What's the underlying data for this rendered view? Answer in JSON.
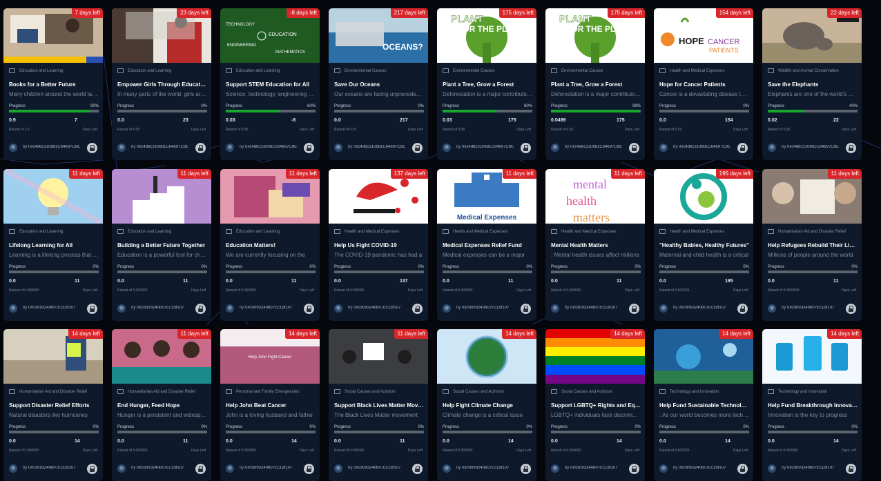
{
  "campaigns": [
    {
      "category": "Education and Learning",
      "title": "Books for a Better Future",
      "description": "Many children around the world lack access to books",
      "progress_label": "Progress",
      "progress_pct_text": "90%",
      "progress": 0.9,
      "raised": "0.9",
      "raised_of": "Raised of 1.0",
      "days": "7",
      "days_left_label": "Days Left",
      "days_badge": "7 days left",
      "creator_prefix": "by",
      "creator": "0xc4d6c310881C64697C8E",
      "thumb": "books"
    },
    {
      "category": "Education and Learning",
      "title": "Empower Girls Through Education",
      "description": "In many parts of the world, girls are denied",
      "progress_label": "Progress",
      "progress_pct_text": "0%",
      "progress": 0,
      "raised": "0.0",
      "raised_of": "Raised of 0.05",
      "days": "23",
      "days_left_label": "Days Left",
      "days_badge": "23 days left",
      "creator_prefix": "by",
      "creator": "0xc4d6c310881C64697C8E",
      "thumb": "girls"
    },
    {
      "category": "Education and Learning",
      "title": "Support STEM Education for All",
      "description": "Science, technology, engineering and math",
      "progress_label": "Progress",
      "progress_pct_text": "60%",
      "progress": 0.6,
      "raised": "0.03",
      "raised_of": "Raised of 0.05",
      "days": "-8",
      "days_left_label": "Days Left",
      "days_badge": "-8 days left",
      "creator_prefix": "by",
      "creator": "0xc4d6c310881C64697C8E",
      "thumb": "stem"
    },
    {
      "category": "Environmental Causes",
      "title": "Save Our Oceans",
      "description": "Our oceans are facing unprecedented threats",
      "progress_label": "Progress",
      "progress_pct_text": "0%",
      "progress": 0,
      "raised": "0.0",
      "raised_of": "Raised of 0.05",
      "days": "217",
      "days_left_label": "Days Left",
      "days_badge": "217 days left",
      "creator_prefix": "by",
      "creator": "0xc4d6c310881C64697C8E",
      "thumb": "oceans"
    },
    {
      "category": "Environmental Causes",
      "title": "Plant a Tree, Grow a Forest",
      "description": "Deforestation is a major contributor to climate",
      "progress_label": "Progress",
      "progress_pct_text": "60%",
      "progress": 0.6,
      "raised": "0.03",
      "raised_of": "Raised of 0.05",
      "days": "175",
      "days_left_label": "Days Left",
      "days_badge": "175 days left",
      "creator_prefix": "by",
      "creator": "0xc4d6c310881C64697C8E",
      "thumb": "plant"
    },
    {
      "category": "Environmental Causes",
      "title": "Plant a Tree, Grow a Forest",
      "description": "Deforestation is a major contributor to climate",
      "progress_label": "Progress",
      "progress_pct_text": "99%",
      "progress": 0.99,
      "raised": "0.0499",
      "raised_of": "Raised of 0.05",
      "days": "175",
      "days_left_label": "Days Left",
      "days_badge": "175 days left",
      "creator_prefix": "by",
      "creator": "0xc4d6c310881C64697C8E",
      "thumb": "plant"
    },
    {
      "category": "Health and Medical Expenses",
      "title": "Hope for Cancer Patients",
      "description": "Cancer is a devastating disease that affects",
      "progress_label": "Progress",
      "progress_pct_text": "0%",
      "progress": 0,
      "raised": "0.0",
      "raised_of": "Raised of 0.05",
      "days": "154",
      "days_left_label": "Days Left",
      "days_badge": "154 days left",
      "creator_prefix": "by",
      "creator": "0xc4d6c310881C64697C8E",
      "thumb": "hope"
    },
    {
      "category": "Wildlife and Animal Conservation",
      "title": "Save the Elephants",
      "description": "Elephants are one of the world's most iconic",
      "progress_label": "Progress",
      "progress_pct_text": "40%",
      "progress": 0.4,
      "raised": "0.02",
      "raised_of": "Raised of 0.05",
      "days": "22",
      "days_left_label": "Days Left",
      "days_badge": "22 days left",
      "creator_prefix": "by",
      "creator": "0xc4d6c310881C64697C8E",
      "thumb": "elephant"
    },
    {
      "category": "Education and Learning",
      "title": "Lifelong Learning for All",
      "description": "Learning is a lifelong process that helps",
      "progress_label": "Progress",
      "progress_pct_text": "0%",
      "progress": 0,
      "raised": "0.0",
      "raised_of": "Raised of 0.000000",
      "days": "11",
      "days_left_label": "Days Left",
      "days_badge": "11 days left",
      "creator_prefix": "by",
      "creator": "0x03093240b07Ec1df107",
      "thumb": "bulb"
    },
    {
      "category": "Education and Learning",
      "title": "Building a Better Future Together",
      "description": "Education is a powerful tool for change",
      "progress_label": "Progress",
      "progress_pct_text": "0%",
      "progress": 0,
      "raised": "0.0",
      "raised_of": "Raised of 0.000000",
      "days": "11",
      "days_left_label": "Days Left",
      "days_badge": "11 days left",
      "creator_prefix": "by",
      "creator": "0x03093240b07Ec1df107",
      "thumb": "future"
    },
    {
      "category": "Education and Learning",
      "title": "Education Matters!",
      "description": "We are currently focusing on the",
      "progress_label": "Progress",
      "progress_pct_text": "0%",
      "progress": 0,
      "raised": "0.0",
      "raised_of": "Raised of 0.000000",
      "days": "11",
      "days_left_label": "Days Left",
      "days_badge": "11 days left",
      "creator_prefix": "by",
      "creator": "0x03093240b07Ec1df107",
      "thumb": "edumatters"
    },
    {
      "category": "Health and Medical Expenses",
      "title": "Help Us Fight COVID-19",
      "description": "The COVID-19 pandemic has had a",
      "progress_label": "Progress",
      "progress_pct_text": "0%",
      "progress": 0,
      "raised": "0.0",
      "raised_of": "Raised of 0.000000",
      "days": "137",
      "days_left_label": "Days Left",
      "days_badge": "137 days left",
      "creator_prefix": "by",
      "creator": "0x03093240b07Ec1df107",
      "thumb": "covid"
    },
    {
      "category": "Health and Medical Expenses",
      "title": "Medical Expenses Relief Fund",
      "description": "Medical expenses can be a major",
      "progress_label": "Progress",
      "progress_pct_text": "0%",
      "progress": 0,
      "raised": "0.0",
      "raised_of": "Raised of 0.000000",
      "days": "11",
      "days_left_label": "Days Left",
      "days_badge": "11 days left",
      "creator_prefix": "by",
      "creator": "0x03093240b07Ec1df107",
      "thumb": "medical",
      "thumb_text": "Medical Expenses"
    },
    {
      "category": "Health and Medical Expenses",
      "title": "Mental Health Matters",
      "description": ": Mental health issues affect millions",
      "progress_label": "Progress",
      "progress_pct_text": "0%",
      "progress": 0,
      "raised": "0.0",
      "raised_of": "Raised of 0.000000",
      "days": "11",
      "days_left_label": "Days Left",
      "days_badge": "11 days left",
      "creator_prefix": "by",
      "creator": "0x03093240b07Ec1df107",
      "thumb": "mental"
    },
    {
      "category": "Health and Medical Expenses",
      "title": "\"Healthy Babies, Healthy Futures\"",
      "description": "Maternal and child health is a critical",
      "progress_label": "Progress",
      "progress_pct_text": "0%",
      "progress": 0,
      "raised": "0.0",
      "raised_of": "Raised of 0.000000",
      "days": "195",
      "days_left_label": "Days Left",
      "days_badge": "195 days left",
      "creator_prefix": "by",
      "creator": "0x03093240b07Ec1df107",
      "thumb": "babies"
    },
    {
      "category": "Humanitarian Aid and Disaster Relief",
      "title": "Help Refugees Rebuild Their Lives",
      "description": "Millions of people around the world",
      "progress_label": "Progress",
      "progress_pct_text": "0%",
      "progress": 0,
      "raised": "0.0",
      "raised_of": "Raised of 0.0000001",
      "days": "11",
      "days_left_label": "Days Left",
      "days_badge": "11 days left",
      "creator_prefix": "by",
      "creator": "0x03093240b07Ec1df107",
      "thumb": "refugees"
    },
    {
      "category": "Humanitarian Aid and Disaster Relief",
      "title": "Support Disaster Relief Efforts",
      "description": "Natural disasters like hurricanes",
      "progress_label": "Progress",
      "progress_pct_text": "0%",
      "progress": 0,
      "raised": "0.0",
      "raised_of": "Raised of 0.000000",
      "days": "14",
      "days_left_label": "Days Left",
      "days_badge": "14 days left",
      "creator_prefix": "by",
      "creator": "0x03093240b07Ec1df107",
      "thumb": "disaster"
    },
    {
      "category": "Humanitarian Aid and Disaster Relief",
      "title": "End Hunger, Feed Hope",
      "description": "Hunger is a persistent and widespread",
      "progress_label": "Progress",
      "progress_pct_text": "0%",
      "progress": 0,
      "raised": "0.0",
      "raised_of": "Raised of 0.000000",
      "days": "11",
      "days_left_label": "Days Left",
      "days_badge": "11 days left",
      "creator_prefix": "by",
      "creator": "0x03093240b07Ec1df107",
      "thumb": "hunger"
    },
    {
      "category": "Personal and Family Emergencies",
      "title": "Help John Beat Cancer",
      "description": "John is a loving husband and father",
      "progress_label": "Progress",
      "progress_pct_text": "0%",
      "progress": 0,
      "raised": "0.0",
      "raised_of": "Raised of 0.000000",
      "days": "14",
      "days_left_label": "Days Left",
      "days_badge": "14 days left",
      "creator_prefix": "by",
      "creator": "0x03093240b07Ec1df107",
      "thumb": "john",
      "thumb_text": "Help John Fight Cancer"
    },
    {
      "category": "Social Causes and Activism",
      "title": "Support Black Lives Matter Movement",
      "description": "The Black Lives Matter movement",
      "progress_label": "Progress",
      "progress_pct_text": "0%",
      "progress": 0,
      "raised": "0.0",
      "raised_of": "Raised of 0.000000",
      "days": "11",
      "days_left_label": "Days Left",
      "days_badge": "11 days left",
      "creator_prefix": "by",
      "creator": "0x03093240b07Ec1df107",
      "thumb": "blm"
    },
    {
      "category": "Social Causes and Activism",
      "title": "Help Fight Climate Change",
      "description": "Climate change is a critical issue",
      "progress_label": "Progress",
      "progress_pct_text": "0%",
      "progress": 0,
      "raised": "0.0",
      "raised_of": "Raised of 0.000000",
      "days": "14",
      "days_left_label": "Days Left",
      "days_badge": "14 days left",
      "creator_prefix": "by",
      "creator": "0x03093240b07Ec1df107",
      "thumb": "climate"
    },
    {
      "category": "Social Causes and Activism",
      "title": "Support LGBTQ+ Rights and Equality",
      "description": "LGBTQ+ individuals face discrimination",
      "progress_label": "Progress",
      "progress_pct_text": "0%",
      "progress": 0,
      "raised": "0.0",
      "raised_of": "Raised of 0.000000",
      "days": "14",
      "days_left_label": "Days Left",
      "days_badge": "14 days left",
      "creator_prefix": "by",
      "creator": "0x03093240b07Ec1df107",
      "thumb": "lgbt"
    },
    {
      "category": "Technology and Innovation",
      "title": "Help Fund Sustainable Technology",
      "description": ": As our world becomes more technology",
      "progress_label": "Progress",
      "progress_pct_text": "0%",
      "progress": 0,
      "raised": "0.0",
      "raised_of": "Raised of 0.000000",
      "days": "14",
      "days_left_label": "Days Left",
      "days_badge": "14 days left",
      "creator_prefix": "by",
      "creator": "0x03093240b07Ec1df107",
      "thumb": "sustain"
    },
    {
      "category": "Technology and Innovation",
      "title": "Help Fund Breakthrough Innovation",
      "description": "Innovation is the key to progress",
      "progress_label": "Progress",
      "progress_pct_text": "0%",
      "progress": 0,
      "raised": "0.0",
      "raised_of": "Raised of 0.000000",
      "days": "14",
      "days_left_label": "Days Left",
      "days_badge": "14 days left",
      "creator_prefix": "by",
      "creator": "0x03093240b07Ec1df107",
      "thumb": "innovation"
    }
  ],
  "colors": {
    "badge": "#d8262b",
    "progress_fill": "#17a62e",
    "progress_track": "#5d646d",
    "card_bg": "#0e1a2b",
    "page_bg": "#05070c"
  },
  "icons": {
    "category": "folder-icon",
    "creator": "avatar-icon",
    "action": "lock-icon"
  }
}
